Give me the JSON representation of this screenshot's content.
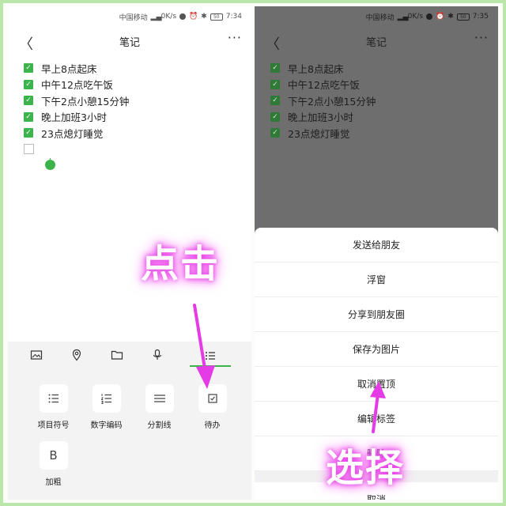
{
  "status": {
    "left": {
      "carrier": "中国移动",
      "net": "K/s",
      "net_val": "0",
      "batt": "50",
      "time": "7:34"
    },
    "right": {
      "carrier": "中国移动",
      "net": "K/s",
      "net_val": "0",
      "batt": "50",
      "time": "7:35"
    }
  },
  "header": {
    "title": "笔记",
    "back": "〈",
    "more": "···"
  },
  "todos": [
    {
      "text": "早上8点起床",
      "checked": true
    },
    {
      "text": "中午12点吃午饭",
      "checked": true
    },
    {
      "text": "下午2点小憩15分钟",
      "checked": true
    },
    {
      "text": "晚上加班3小时",
      "checked": true
    },
    {
      "text": "23点熄灯睡觉",
      "checked": true
    }
  ],
  "toolbar": {
    "icons": [
      "image-icon",
      "location-icon",
      "folder-icon",
      "microphone-icon",
      "list-icon"
    ],
    "active": "list-icon"
  },
  "format_panel": {
    "buttons": [
      {
        "label": "项目符号",
        "icon": "bullet-list-icon"
      },
      {
        "label": "数字编码",
        "icon": "numbered-list-icon"
      },
      {
        "label": "分割线",
        "icon": "divider-icon"
      },
      {
        "label": "待办",
        "icon": "checkbox-icon"
      },
      {
        "label": "加粗",
        "icon": "bold-icon",
        "glyph": "B"
      }
    ]
  },
  "annotations": {
    "click": "点击",
    "select": "选择",
    "color": "#e53be6"
  },
  "share_sheet": {
    "items": [
      "发送给朋友",
      "浮窗",
      "分享到朋友圈",
      "保存为图片",
      "取消置顶",
      "编辑标签",
      "删除"
    ],
    "cancel": "取消"
  },
  "colors": {
    "accent": "#3cb44b",
    "border": "#b9e6a9",
    "overlay": "#6e6e6e"
  }
}
